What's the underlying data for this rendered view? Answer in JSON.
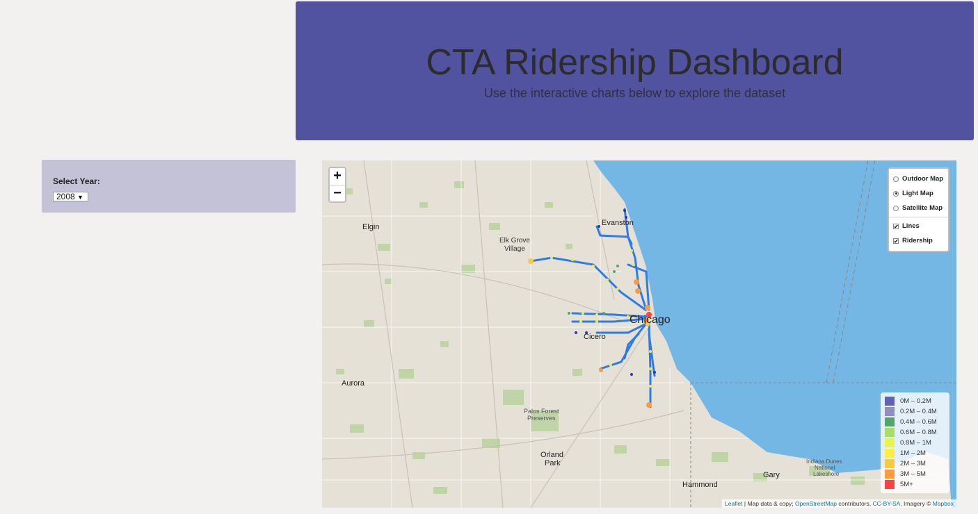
{
  "header": {
    "title": "CTA Ridership Dashboard",
    "subtitle": "Use the interactive charts below to explore the dataset"
  },
  "sidebar": {
    "year_label": "Select Year:",
    "year_value": "2008"
  },
  "map": {
    "zoom_in": "+",
    "zoom_out": "−",
    "base_layers": [
      {
        "label": "Outdoor Map",
        "selected": false
      },
      {
        "label": "Light Map",
        "selected": true
      },
      {
        "label": "Satellite Map",
        "selected": false
      }
    ],
    "overlays": [
      {
        "label": "Lines",
        "checked": true
      },
      {
        "label": "Ridership",
        "checked": true
      }
    ],
    "legend": [
      {
        "label": "0M – 0.2M",
        "color": "#6161b8"
      },
      {
        "label": "0.2M – 0.4M",
        "color": "#9090bc"
      },
      {
        "label": "0.4M – 0.6M",
        "color": "#4fa86a"
      },
      {
        "label": "0.6M – 0.8M",
        "color": "#a8dd66"
      },
      {
        "label": "0.8M – 1M",
        "color": "#e6f547"
      },
      {
        "label": "1M – 2M",
        "color": "#fbef47"
      },
      {
        "label": "2M – 3M",
        "color": "#fcc93d"
      },
      {
        "label": "3M – 5M",
        "color": "#fb9c40"
      },
      {
        "label": "5M+",
        "color": "#f94545"
      }
    ],
    "places": {
      "elgin": "Elgin",
      "evanston": "Evanston",
      "elk_grove": "Elk Grove",
      "village": "Village",
      "chicago": "Chicago",
      "cicero": "Cicero",
      "aurora": "Aurora",
      "palos": "Palos Forest",
      "preserves": "Preserves",
      "orland": "Orland",
      "park": "Park",
      "hammond": "Hammond",
      "gary": "Gary",
      "dunes": "Indiana Dunes",
      "national": "National",
      "lakeshore": "Lakeshore"
    },
    "attribution": {
      "leaflet": "Leaflet",
      "text1": " | Map data & copy; ",
      "osm": "OpenStreetMap",
      "text2": " contributors, ",
      "ccbysa": "CC-BY-SA",
      "text3": ", Imagery © ",
      "mapbox": "Mapbox"
    }
  }
}
